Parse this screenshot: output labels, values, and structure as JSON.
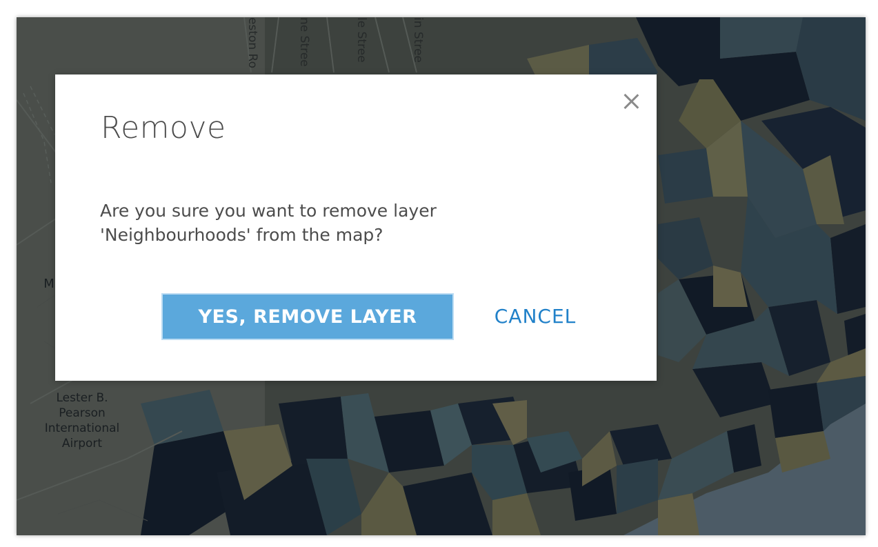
{
  "map": {
    "labels": {
      "airport": "Lester B.\nPearson\nInternational\nAirport",
      "partial_left": "M"
    },
    "street_names": {
      "s1": "eston Ro",
      "s2": "ne Stree",
      "s3": "le Stree",
      "s4": "in Stree"
    }
  },
  "dialog": {
    "title": "Remove",
    "message": "Are you sure you want to remove layer 'Neighbourhoods' from the map?",
    "confirm_label": "YES, REMOVE LAYER",
    "cancel_label": "CANCEL",
    "close_icon": "close-icon"
  },
  "colors": {
    "primary_button": "#5ba8dc",
    "link": "#2181c9",
    "title_text": "#4c4c4c"
  }
}
